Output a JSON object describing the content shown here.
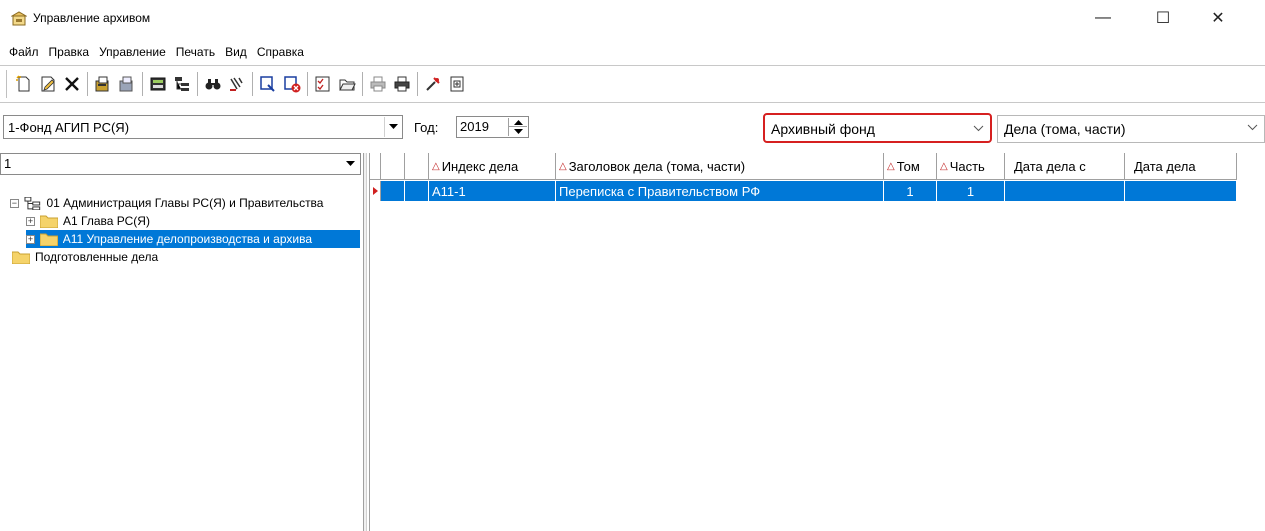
{
  "window": {
    "title": "Управление архивом",
    "controls": {
      "minimize": "—",
      "maximize": "☐",
      "close": "✕"
    }
  },
  "menu": [
    "Файл",
    "Правка",
    "Управление",
    "Печать",
    "Вид",
    "Справка"
  ],
  "toolbar": {
    "groups": [
      [
        "new-doc-icon",
        "edit-doc-icon",
        "delete-icon"
      ],
      [
        "copy-case-icon",
        "paste-case-icon"
      ],
      [
        "calculator-icon",
        "tree-structure-icon"
      ],
      [
        "binoculars-search-icon",
        "filter-icon"
      ],
      [
        "select-window-icon",
        "cancel-select-icon"
      ],
      [
        "checklist-icon",
        "open-folder-icon"
      ],
      [
        "print-icon",
        "print-preview-icon"
      ],
      [
        "tools-icon",
        "report-icon"
      ]
    ]
  },
  "filters": {
    "fund": "1-Фонд АГИП РС(Я)",
    "year_label": "Год:",
    "year": "2019",
    "archive_type": "Архивный фонд",
    "record_type": "Дела (тома, части)"
  },
  "left": {
    "node_value": "1",
    "tree": [
      {
        "label": "01 Администрация Главы РС(Я) и Правительства",
        "level": 0,
        "expander": "−",
        "icon": "structure",
        "selected": false
      },
      {
        "label": "А1 Глава РС(Я)",
        "level": 1,
        "expander": "+",
        "icon": "folder",
        "selected": false
      },
      {
        "label": "А11 Управление делопроизводства и архива",
        "level": 1,
        "expander": "+",
        "icon": "folder",
        "selected": true
      },
      {
        "label": "Подготовленные дела",
        "level": 0,
        "expander": "",
        "icon": "folder",
        "selected": false
      }
    ]
  },
  "grid": {
    "columns": [
      {
        "label": "",
        "sort": false
      },
      {
        "label": "",
        "sort": false
      },
      {
        "label": "",
        "sort": false
      },
      {
        "label": "Индекс дела",
        "sort": true
      },
      {
        "label": "Заголовок дела (тома, части)",
        "sort": true
      },
      {
        "label": "Том",
        "sort": true
      },
      {
        "label": "Часть",
        "sort": true
      },
      {
        "label": "Дата дела с",
        "sort": false
      },
      {
        "label": "Дата дела",
        "sort": false
      }
    ],
    "rows": [
      {
        "index": "А11-1",
        "title": "Переписка с Правительством РФ",
        "volume": "1",
        "part": "1",
        "date_from": "",
        "date_to": ""
      }
    ]
  },
  "colors": {
    "selection": "#0078d7",
    "highlight_border": "#d62020",
    "sort_marker": "#c02020"
  }
}
